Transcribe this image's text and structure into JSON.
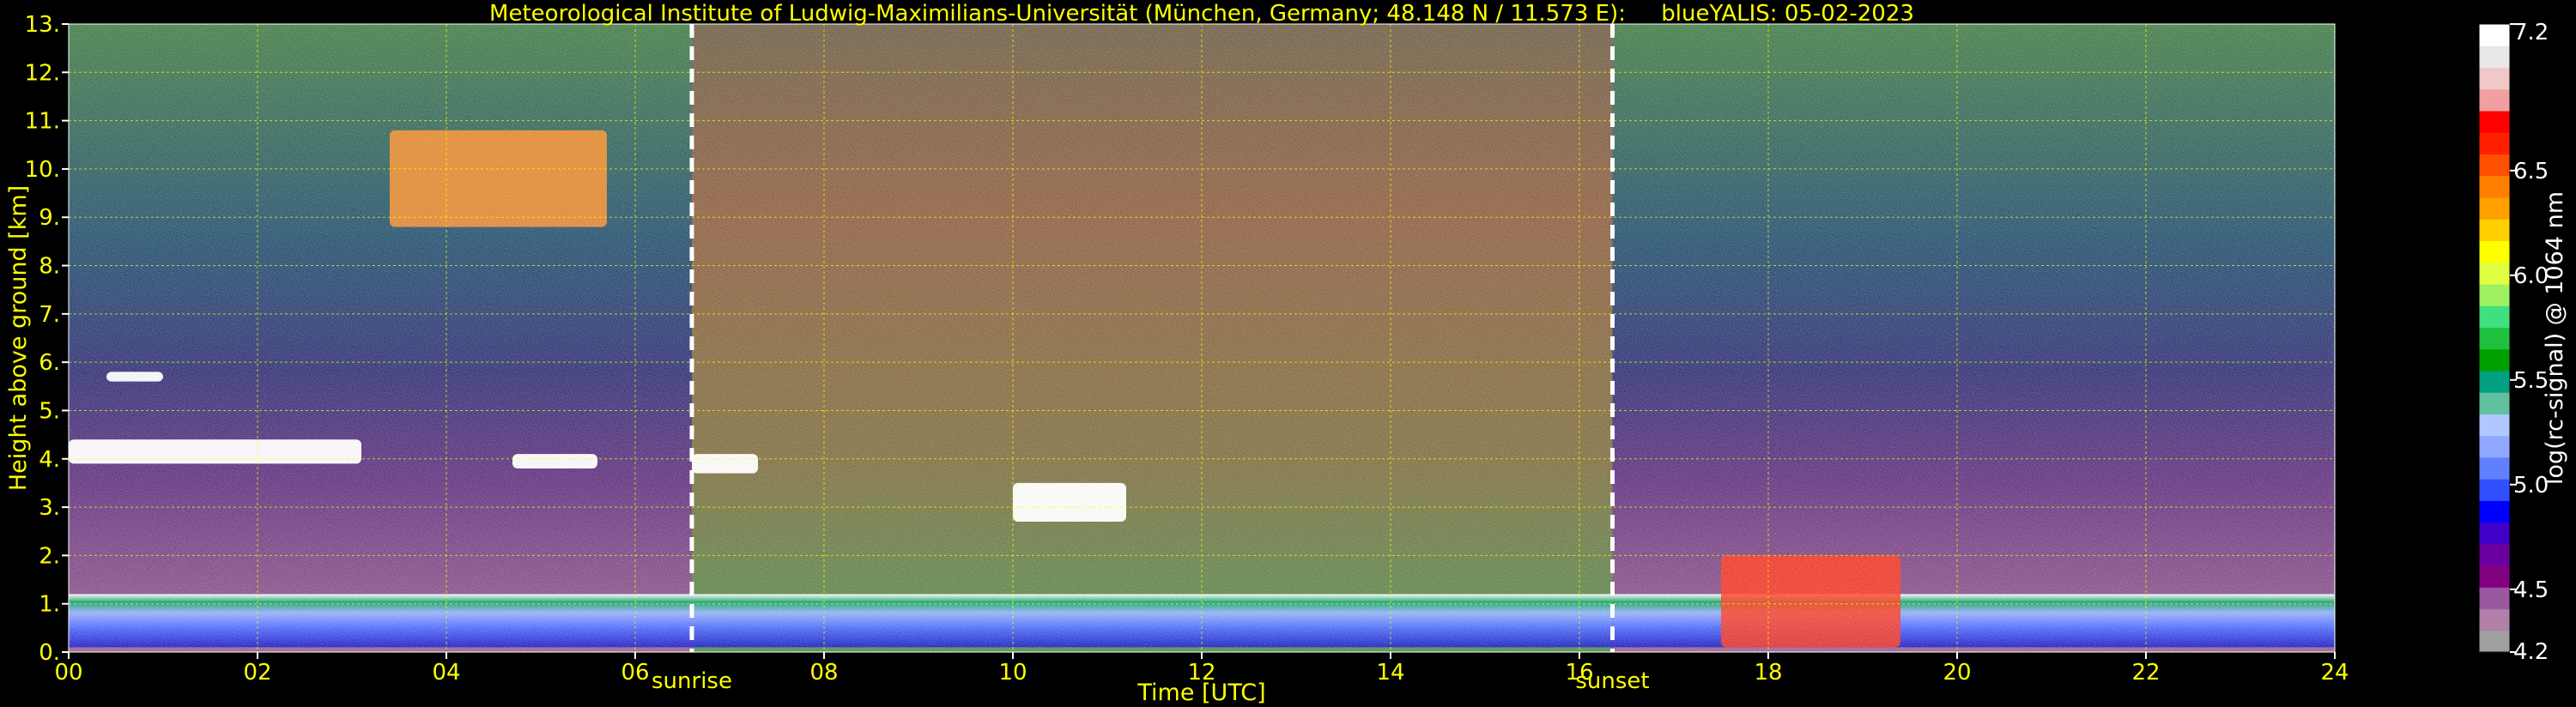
{
  "chart_data": {
    "type": "heatmap",
    "title": "Meteorological Institute of Ludwig-Maximilians-Universität (München, Germany; 48.148 N / 11.573 E):     blueYALIS: 05-02-2023",
    "xlabel": "Time [UTC]",
    "ylabel": "Height above ground [km]",
    "xlim": [
      0,
      24
    ],
    "ylim": [
      0,
      13
    ],
    "x_ticks": [
      "00",
      "02",
      "04",
      "06",
      "08",
      "10",
      "12",
      "14",
      "16",
      "18",
      "20",
      "22",
      "24"
    ],
    "y_ticks": [
      "0.",
      "1.",
      "2.",
      "3.",
      "4.",
      "5.",
      "6.",
      "7.",
      "8.",
      "9.",
      "10.",
      "11.",
      "12.",
      "13."
    ],
    "grid": true,
    "events": [
      {
        "label": "sunrise",
        "time": 6.6
      },
      {
        "label": "sunset",
        "time": 16.35
      }
    ],
    "colorbar": {
      "label": "log(rc-signal) @ 1064 nm",
      "range": [
        4.2,
        7.2
      ],
      "ticks": [
        "4.2",
        "4.5",
        "5.0",
        "5.5",
        "6.0",
        "6.5",
        "7.2"
      ],
      "colors": [
        "#a0a0a0",
        "#b080a8",
        "#9a58a0",
        "#800080",
        "#6a00a0",
        "#4000c8",
        "#0000ff",
        "#3050ff",
        "#6080ff",
        "#90a8ff",
        "#b0c8ff",
        "#60c0a0",
        "#00a080",
        "#00a000",
        "#20c040",
        "#40e080",
        "#a0f060",
        "#e0ff40",
        "#ffff00",
        "#ffd000",
        "#ffa000",
        "#ff8000",
        "#ff5000",
        "#ff2000",
        "#ff0000",
        "#f0a0a0",
        "#f0c8c8",
        "#e8e8e8",
        "#ffffff"
      ]
    },
    "features": [
      {
        "kind": "boundary layer",
        "t_start": 0,
        "t_end": 24,
        "height_km": [
          0.1,
          1.2
        ]
      },
      {
        "kind": "cirrus",
        "t_start": 3.4,
        "t_end": 5.7,
        "height_km": [
          8.8,
          10.8
        ]
      },
      {
        "kind": "cloud",
        "t_start": 0.4,
        "t_end": 1.0,
        "height_km": [
          5.6,
          5.8
        ]
      },
      {
        "kind": "cloud",
        "t_start": 0,
        "t_end": 3.1,
        "height_km": [
          3.9,
          4.4
        ]
      },
      {
        "kind": "cloud",
        "t_start": 4.7,
        "t_end": 5.6,
        "height_km": [
          3.8,
          4.1
        ]
      },
      {
        "kind": "cloud",
        "t_start": 6.6,
        "t_end": 7.3,
        "height_km": [
          3.7,
          4.1
        ]
      },
      {
        "kind": "cloud",
        "t_start": 10.0,
        "t_end": 11.2,
        "height_km": [
          2.7,
          3.5
        ]
      },
      {
        "kind": "convective",
        "t_start": 17.5,
        "t_end": 19.4,
        "height_km": [
          0.1,
          2.0
        ]
      }
    ]
  }
}
